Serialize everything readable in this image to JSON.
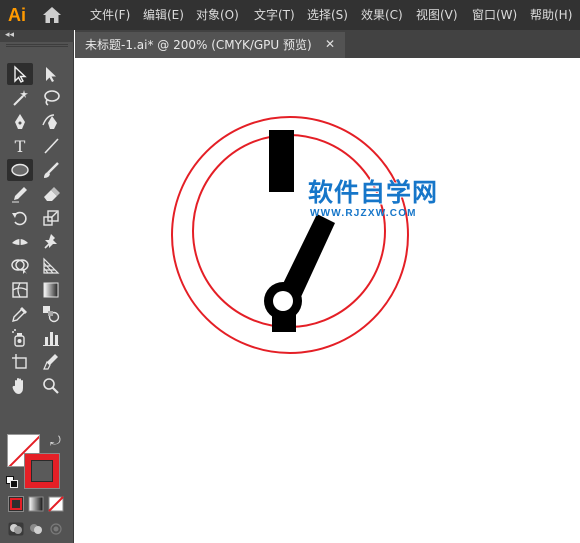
{
  "app": {
    "logo": "Ai"
  },
  "menu": [
    {
      "label": "文件(F)"
    },
    {
      "label": "编辑(E)"
    },
    {
      "label": "对象(O)"
    },
    {
      "label": "文字(T)"
    },
    {
      "label": "选择(S)"
    },
    {
      "label": "效果(C)"
    },
    {
      "label": "视图(V)"
    },
    {
      "label": "窗口(W)"
    },
    {
      "label": "帮助(H)"
    }
  ],
  "panel": {
    "collapse_glyph": "◂◂"
  },
  "document": {
    "tab_title": "未标题-1.ai* @ 200% (CMYK/GPU 预览)",
    "close_glyph": "✕"
  },
  "tools": {
    "type_glyph": "T",
    "swap_glyph": "⤾",
    "icons": [
      "selection-tool-icon",
      "direct-selection-tool-icon",
      "magic-wand-icon",
      "lasso-icon",
      "pen-tool-icon",
      "curvature-tool-icon",
      "type-tool-icon",
      "line-segment-icon",
      "ellipse-tool-icon",
      "paintbrush-icon",
      "pencil-icon",
      "eraser-icon",
      "rotate-icon",
      "scale-icon",
      "width-tool-icon",
      "puppet-warp-icon",
      "shape-builder-icon",
      "perspective-grid-icon",
      "mesh-icon",
      "gradient-icon",
      "eyedropper-icon",
      "blend-icon",
      "symbol-sprayer-icon",
      "column-graph-icon",
      "artboard-icon",
      "slice-icon",
      "hand-icon",
      "zoom-icon"
    ]
  },
  "colors": {
    "fill": "#ffffff",
    "stroke": "#e41f26",
    "accent_logo": "#ff9a00",
    "shape": "#000000"
  },
  "watermark": {
    "title": "软件自学网",
    "url": "WWW.RJZXW.COM"
  }
}
